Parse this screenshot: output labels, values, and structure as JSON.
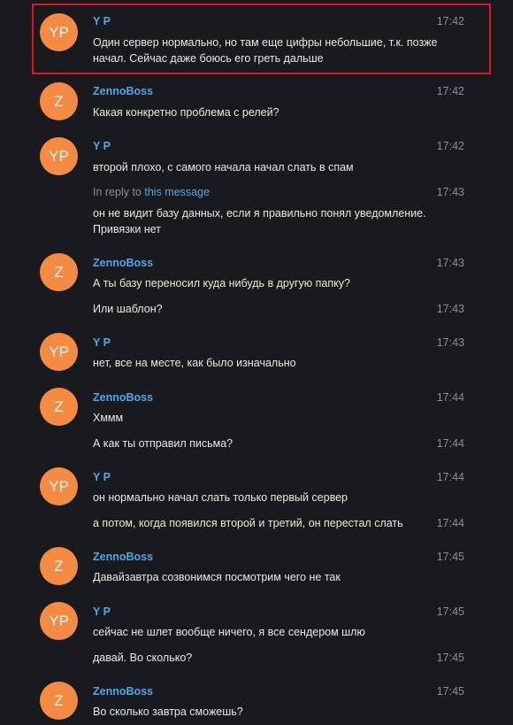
{
  "messages": [
    {
      "author": "Y P",
      "avatar": "YP",
      "time": "17:42",
      "text": "Один сервер нормально, но там еще цифры небольшие, т.к. позже начал. Сейчас даже боюсь его греть дальше"
    },
    {
      "author": "ZennoBoss",
      "avatar": "Z",
      "time": "17:42",
      "text": "Какая конкретно проблема с релей?"
    },
    {
      "author": "Y P",
      "avatar": "YP",
      "time": "17:42",
      "text": "второй плохо, с самого начала начал слать в спам"
    },
    {
      "reply_prefix": "In reply to",
      "reply_link": "this message",
      "time": "17:43",
      "text": "он не видит базу данных, если я правильно понял уведомление. Привязки нет"
    },
    {
      "author": "ZennoBoss",
      "avatar": "Z",
      "time": "17:43",
      "text": "А ты базу переносил куда нибудь в другую папку?"
    },
    {
      "time": "17:43",
      "text": "Или шаблон?"
    },
    {
      "author": "Y P",
      "avatar": "YP",
      "time": "17:43",
      "text": "нет, все на месте, как было изначально"
    },
    {
      "author": "ZennoBoss",
      "avatar": "Z",
      "time": "17:44",
      "text": "Хммм"
    },
    {
      "time": "17:44",
      "text": "А как ты отправил письма?"
    },
    {
      "author": "Y P",
      "avatar": "YP",
      "time": "17:44",
      "text": "он нормально начал слать только первый сервер"
    },
    {
      "time": "17:44",
      "text": "а потом, когда появился второй и третий, он перестал слать"
    },
    {
      "author": "ZennoBoss",
      "avatar": "Z",
      "time": "17:45",
      "text": "Давайзавтра созвонимся посмотрим чего не так"
    },
    {
      "author": "Y P",
      "avatar": "YP",
      "time": "17:45",
      "text": "сейчас не шлет вообще ничего, я все сендером шлю"
    },
    {
      "time": "17:45",
      "text": "давай. Во сколько?"
    },
    {
      "author": "ZennoBoss",
      "avatar": "Z",
      "time": "17:45",
      "text": "Во сколько завтра сможешь?"
    }
  ],
  "colors": {
    "background": "#181a1e",
    "avatar": "#f58a42",
    "author": "#4fa6e8",
    "highlight": "#e0191d"
  }
}
